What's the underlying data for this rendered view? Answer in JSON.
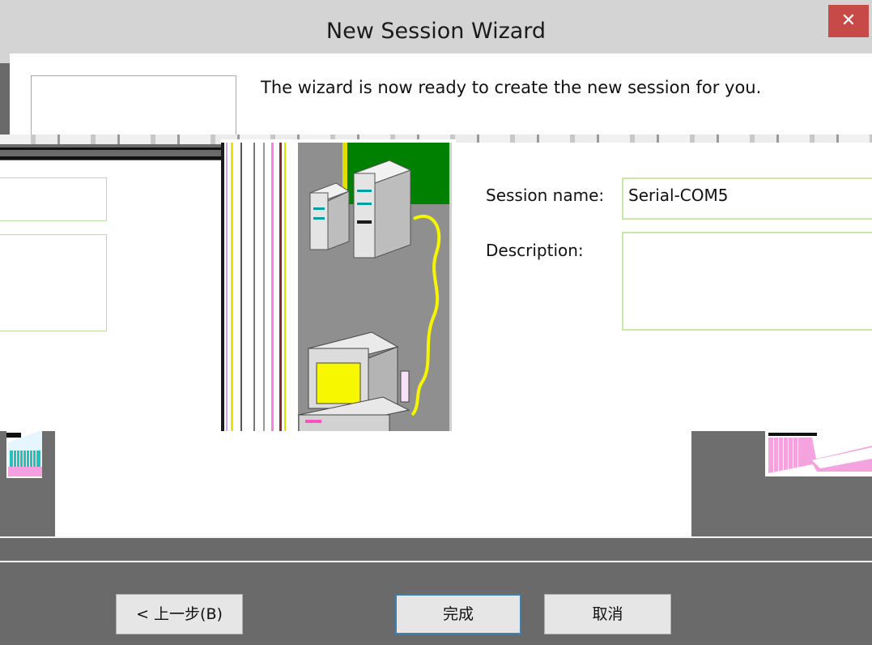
{
  "window": {
    "title": "New Session Wizard",
    "close_glyph": "✕"
  },
  "wizard": {
    "ready_message": "The wizard is now ready to create the new session for you."
  },
  "form": {
    "session_name_label": "Session name:",
    "session_name_value": "Serial-COM5",
    "description_label": "Description:",
    "description_value": ""
  },
  "buttons": {
    "back_label": "< 上一步(B)",
    "finish_label": "完成",
    "cancel_label": "取消"
  },
  "colors": {
    "close_button": "#c74a48",
    "default_button_border": "#3c7fb1",
    "input_border": "#c9e7a9"
  }
}
